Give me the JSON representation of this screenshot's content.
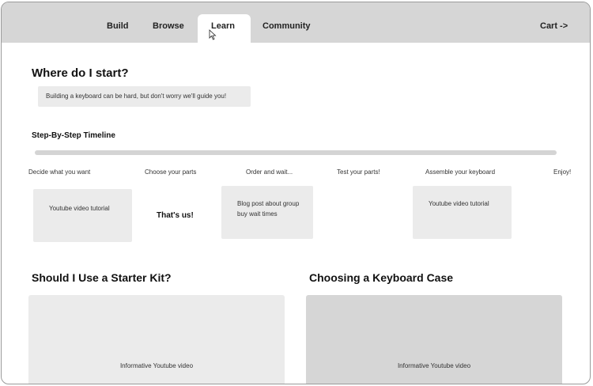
{
  "nav": {
    "items": [
      "Build",
      "Browse",
      "Learn",
      "Community"
    ],
    "active": "Learn",
    "cart_label": "Cart ->"
  },
  "intro": {
    "heading": "Where do I start?",
    "blurb": "Building a keyboard can be hard, but don't worry we'll guide you!"
  },
  "timeline": {
    "title": "Step-By-Step Timeline",
    "steps": [
      "Decide what you want",
      "Choose your parts",
      "Order and wait...",
      "Test your parts!",
      "Assemble your keyboard",
      "Enjoy!"
    ],
    "cards": {
      "video1": "Youtube video tutorial",
      "blog": "Blog post about group buy wait times",
      "video2": "Youtube video tutorial"
    },
    "callout": "That's us!"
  },
  "sections": [
    {
      "heading": "Should I Use a Starter Kit?",
      "video_label": "Informative Youtube video",
      "color": "#ebebeb"
    },
    {
      "heading": "Choosing a Keyboard Case",
      "video_label": "Informative Youtube video",
      "color": "#d6d6d6"
    }
  ],
  "colors": {
    "nav_bg": "#d6d6d6",
    "card_bg": "#ebebeb",
    "active_tab": "#ffffff"
  }
}
